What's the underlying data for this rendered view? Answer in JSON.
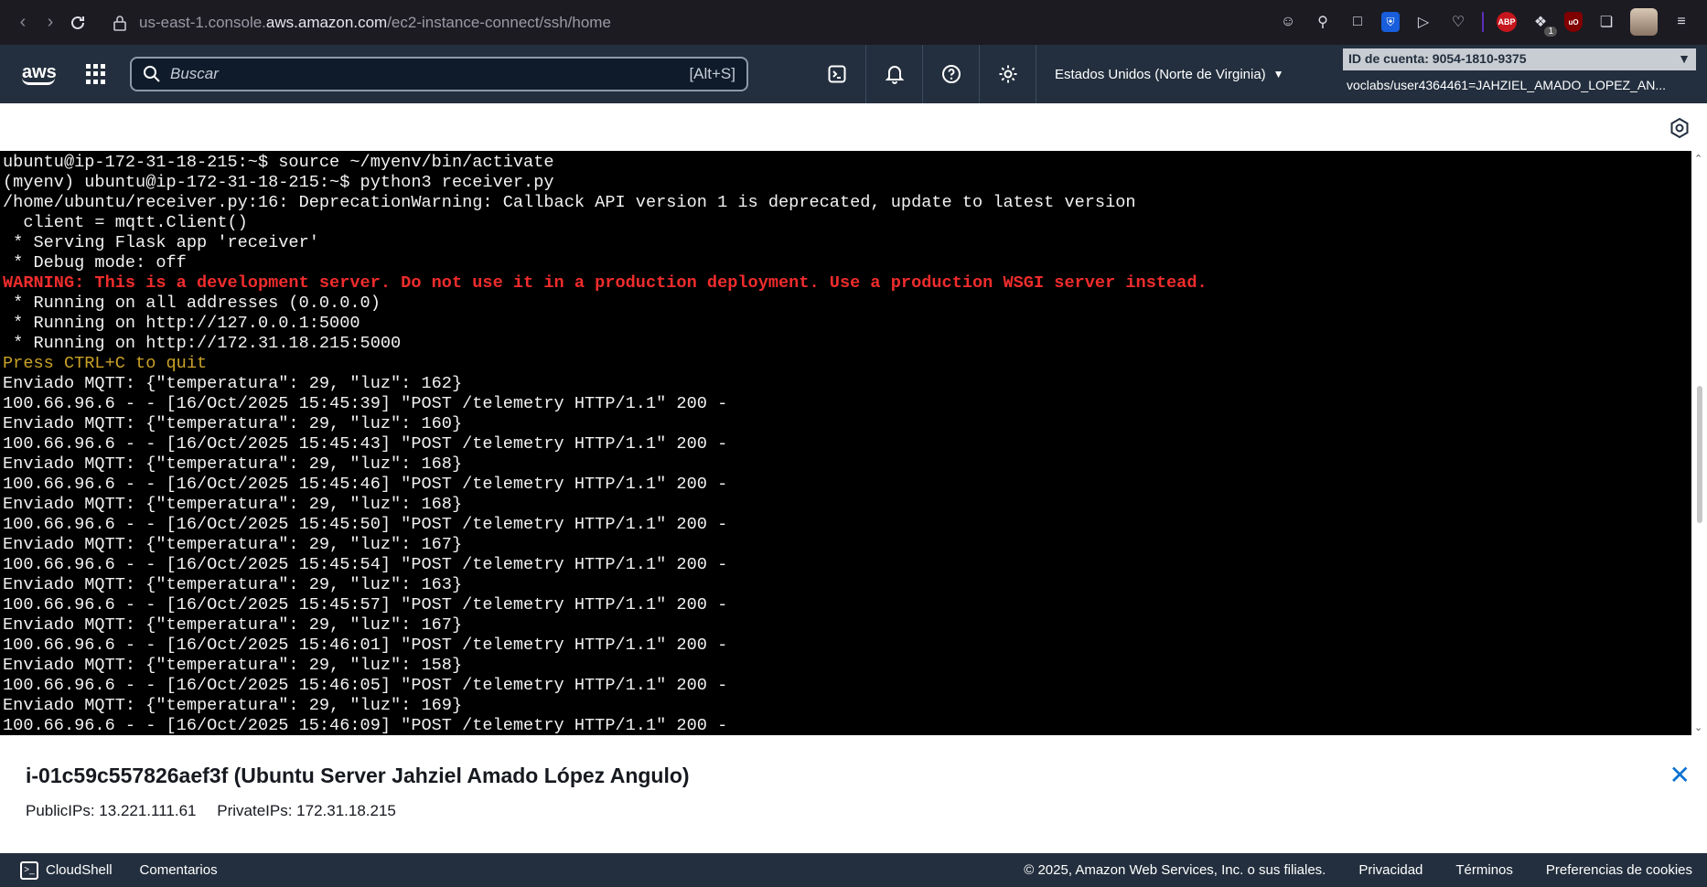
{
  "browser": {
    "url_prefix": "us-east-1.console.",
    "url_host": "aws.amazon.com",
    "url_path": "/ec2-instance-connect/ssh/home",
    "ext_badge": "1"
  },
  "aws_header": {
    "logo_text": "aws",
    "search_placeholder": "Buscar",
    "search_shortcut": "[Alt+S]",
    "region": "Estados Unidos (Norte de Virginia)",
    "account_id": "ID de cuenta: 9054-1810-9375",
    "account_user": "voclabs/user4364461=JAHZIEL_AMADO_LOPEZ_AN..."
  },
  "terminal": {
    "lines": [
      {
        "text": "ubuntu@ip-172-31-18-215:~$ source ~/myenv/bin/activate",
        "style": "normal"
      },
      {
        "text": "(myenv) ubuntu@ip-172-31-18-215:~$ python3 receiver.py",
        "style": "normal"
      },
      {
        "text": "/home/ubuntu/receiver.py:16: DeprecationWarning: Callback API version 1 is deprecated, update to latest version",
        "style": "normal"
      },
      {
        "text": "  client = mqtt.Client()",
        "style": "normal"
      },
      {
        "text": " * Serving Flask app 'receiver'",
        "style": "normal"
      },
      {
        "text": " * Debug mode: off",
        "style": "normal"
      },
      {
        "text": "WARNING: This is a development server. Do not use it in a production deployment. Use a production WSGI server instead.",
        "style": "warn"
      },
      {
        "text": " * Running on all addresses (0.0.0.0)",
        "style": "normal"
      },
      {
        "text": " * Running on http://127.0.0.1:5000",
        "style": "normal"
      },
      {
        "text": " * Running on http://172.31.18.215:5000",
        "style": "normal"
      },
      {
        "text": "Press CTRL+C to quit",
        "style": "hint"
      },
      {
        "text": "Enviado MQTT: {\"temperatura\": 29, \"luz\": 162}",
        "style": "normal"
      },
      {
        "text": "100.66.96.6 - - [16/Oct/2025 15:45:39] \"POST /telemetry HTTP/1.1\" 200 -",
        "style": "normal"
      },
      {
        "text": "Enviado MQTT: {\"temperatura\": 29, \"luz\": 160}",
        "style": "normal"
      },
      {
        "text": "100.66.96.6 - - [16/Oct/2025 15:45:43] \"POST /telemetry HTTP/1.1\" 200 -",
        "style": "normal"
      },
      {
        "text": "Enviado MQTT: {\"temperatura\": 29, \"luz\": 168}",
        "style": "normal"
      },
      {
        "text": "100.66.96.6 - - [16/Oct/2025 15:45:46] \"POST /telemetry HTTP/1.1\" 200 -",
        "style": "normal"
      },
      {
        "text": "Enviado MQTT: {\"temperatura\": 29, \"luz\": 168}",
        "style": "normal"
      },
      {
        "text": "100.66.96.6 - - [16/Oct/2025 15:45:50] \"POST /telemetry HTTP/1.1\" 200 -",
        "style": "normal"
      },
      {
        "text": "Enviado MQTT: {\"temperatura\": 29, \"luz\": 167}",
        "style": "normal"
      },
      {
        "text": "100.66.96.6 - - [16/Oct/2025 15:45:54] \"POST /telemetry HTTP/1.1\" 200 -",
        "style": "normal"
      },
      {
        "text": "Enviado MQTT: {\"temperatura\": 29, \"luz\": 163}",
        "style": "normal"
      },
      {
        "text": "100.66.96.6 - - [16/Oct/2025 15:45:57] \"POST /telemetry HTTP/1.1\" 200 -",
        "style": "normal"
      },
      {
        "text": "Enviado MQTT: {\"temperatura\": 29, \"luz\": 167}",
        "style": "normal"
      },
      {
        "text": "100.66.96.6 - - [16/Oct/2025 15:46:01] \"POST /telemetry HTTP/1.1\" 200 -",
        "style": "normal"
      },
      {
        "text": "Enviado MQTT: {\"temperatura\": 29, \"luz\": 158}",
        "style": "normal"
      },
      {
        "text": "100.66.96.6 - - [16/Oct/2025 15:46:05] \"POST /telemetry HTTP/1.1\" 200 -",
        "style": "normal"
      },
      {
        "text": "Enviado MQTT: {\"temperatura\": 29, \"luz\": 169}",
        "style": "normal"
      },
      {
        "text": "100.66.96.6 - - [16/Oct/2025 15:46:09] \"POST /telemetry HTTP/1.1\" 200 -",
        "style": "normal"
      }
    ]
  },
  "instance": {
    "title": "i-01c59c557826aef3f (Ubuntu Server Jahziel Amado López Angulo)",
    "public_ips": "PublicIPs: 13.221.111.61",
    "private_ips": "PrivateIPs: 172.31.18.215"
  },
  "footer": {
    "cloudshell": "CloudShell",
    "comments": "Comentarios",
    "copyright": "© 2025, Amazon Web Services, Inc. o sus filiales.",
    "privacy": "Privacidad",
    "terms": "Términos",
    "cookies": "Preferencias de cookies"
  },
  "colors": {
    "aws_navy": "#232f3e",
    "terminal_warning": "#ef2c2c",
    "terminal_hint": "#c9a227",
    "link_blue": "#0972d3"
  }
}
